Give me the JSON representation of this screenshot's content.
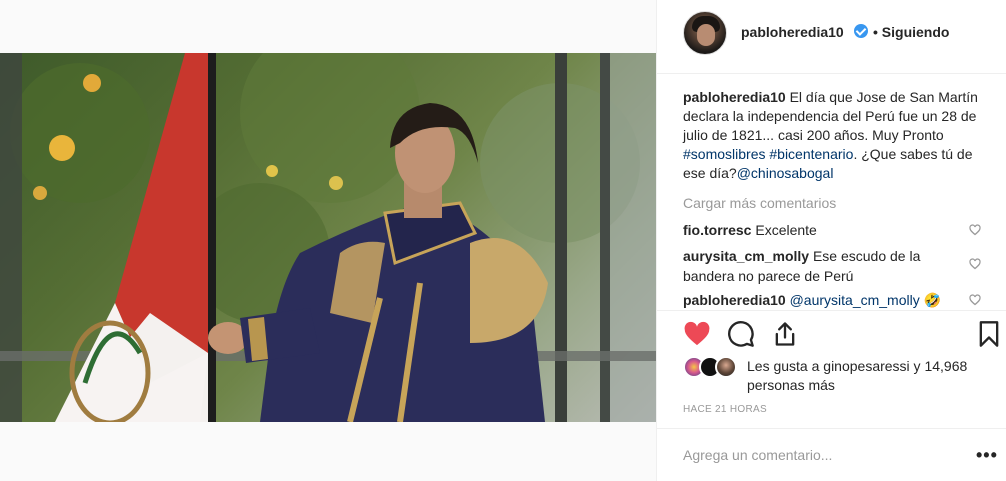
{
  "post": {
    "username": "pabloheredia10",
    "follow_label": "• Siguiendo",
    "verified": true
  },
  "caption": {
    "username": "pabloheredia10",
    "text": " El día que Jose de San Martín declara la independencia del Perú fue un 28 de julio de 1821... casi 200 años. Muy Pronto ",
    "tag1": "#somoslibres",
    "tag2": "#bicentenario",
    "text2": ". ¿Que sabes tú de ese día?",
    "mention": "@chinosabogal"
  },
  "load_more_label": "Cargar más comentarios",
  "comments": [
    {
      "username": "fio.torresc",
      "text": " Excelente"
    },
    {
      "username": "aurysita_cm_molly",
      "text": " Ese escudo de la bandera no parece de Perú"
    },
    {
      "username": "pabloheredia10",
      "mention": " @aurysita_cm_molly",
      "text": " 🤣"
    }
  ],
  "likes": {
    "prefix": "Les gusta a ",
    "liked_by": "ginopesaressi",
    "suffix": " y 14,968 personas más"
  },
  "timestamp": "HACE 21 HORAS",
  "add_comment": {
    "placeholder": "Agrega un comentario..."
  },
  "more_label": "•••",
  "colors": {
    "like_red": "#ed4956",
    "link_blue": "#003569",
    "verified_blue": "#3897f0"
  },
  "icons": [
    "heart-icon",
    "comment-icon",
    "share-icon",
    "bookmark-icon",
    "verified-icon",
    "more-options-icon"
  ]
}
